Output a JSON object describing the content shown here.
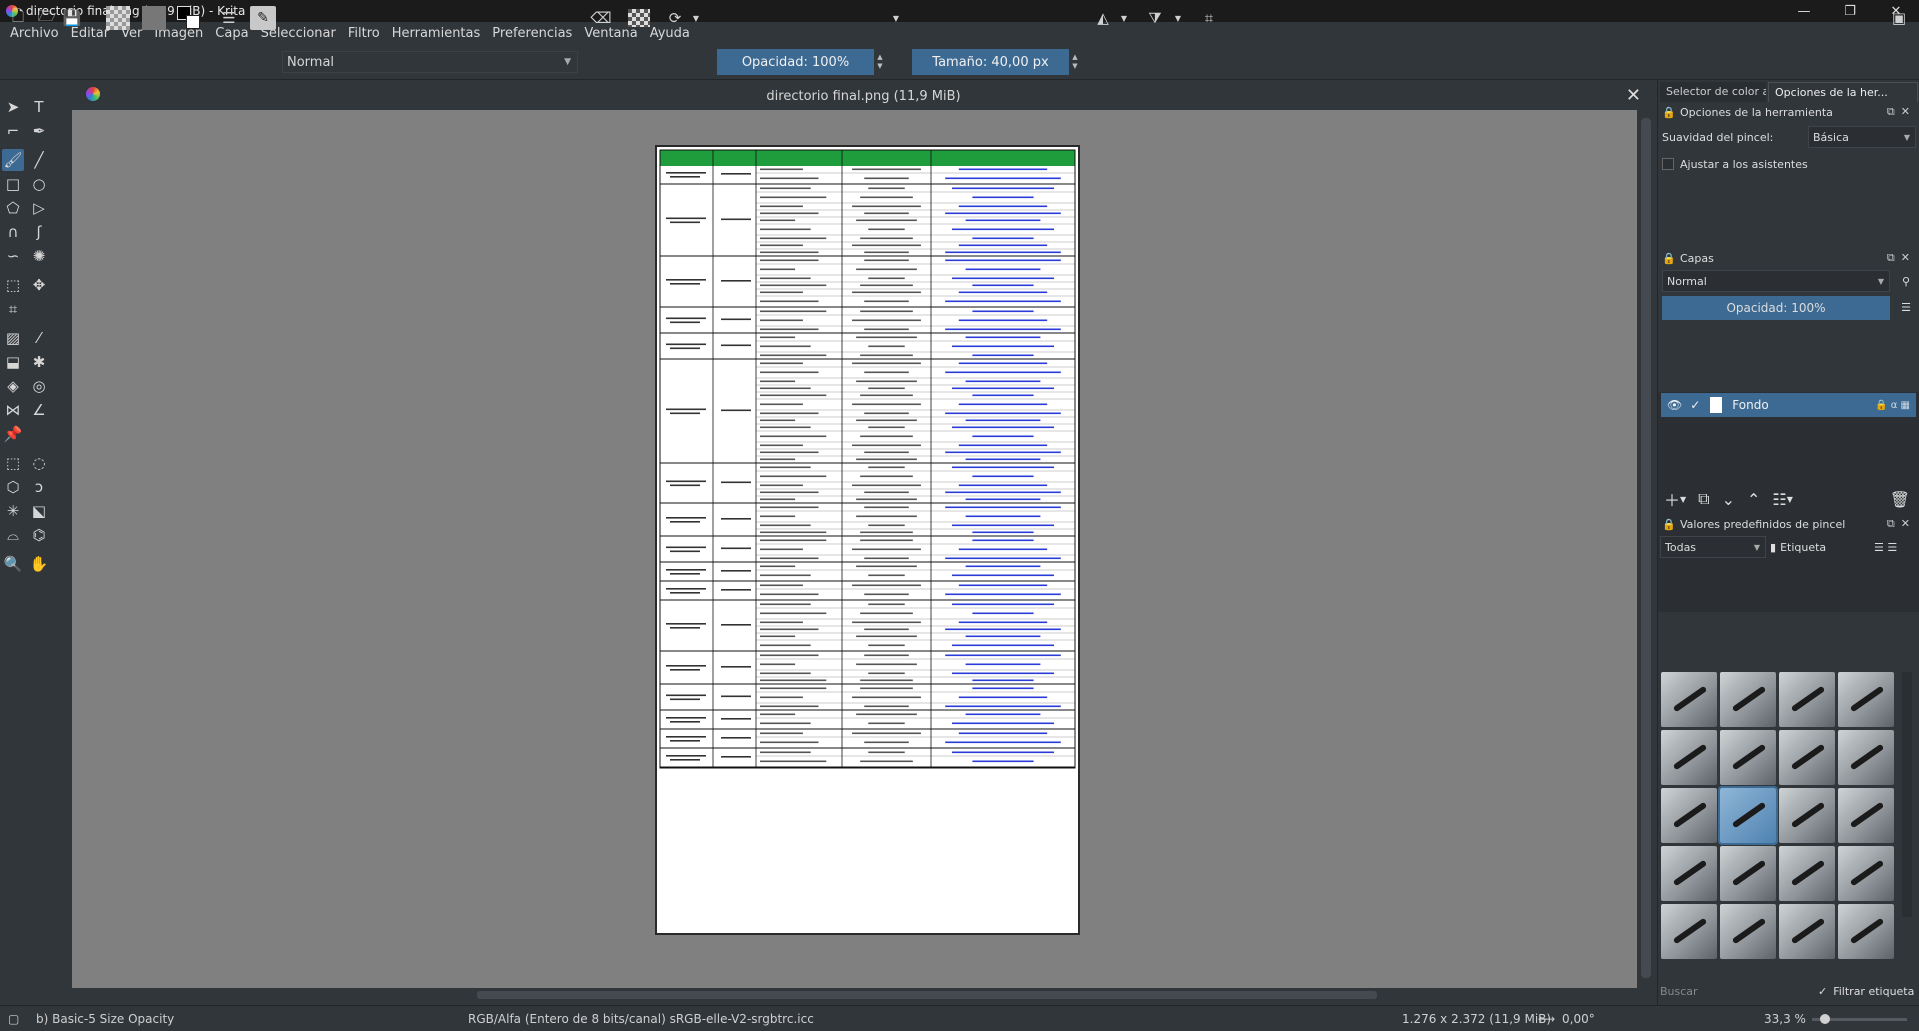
{
  "window": {
    "title": "directorio final.png (11,9 MiB)  - Krita",
    "minimize": "—",
    "maximize": "❐",
    "close": "✕"
  },
  "menu": [
    "Archivo",
    "Editar",
    "Ver",
    "Imagen",
    "Capa",
    "Seleccionar",
    "Filtro",
    "Herramientas",
    "Preferencias",
    "Ventana",
    "Ayuda"
  ],
  "toolbar": {
    "blend_mode": "Normal",
    "opacity_label": "Opacidad: 100%",
    "size_label": "Tamaño: 40,00 px"
  },
  "document": {
    "tab_title": "directorio final.png (11,9 MiB)",
    "close": "✕"
  },
  "dockers": {
    "tab_color_selector": "Selector de color a...",
    "tab_tool_options": "Opciones de la her...",
    "tool_options": {
      "header": "Opciones de la herramienta",
      "smoothing_label": "Suavidad del pincel:",
      "smoothing_value": "Básica",
      "assistants_label": "Ajustar a los asistentes"
    },
    "layers": {
      "header": "Capas",
      "blend_mode": "Normal",
      "opacity_label": "Opacidad:  100%",
      "layer_name": "Fondo"
    },
    "presets": {
      "header": "Valores predefinidos de pincel",
      "filter_all": "Todas",
      "tag_label": "Etiqueta",
      "search_placeholder": "Buscar",
      "filter_tag_label": "Filtrar etiqueta"
    }
  },
  "status": {
    "brush": "b) Basic-5 Size Opacity",
    "color_space": "RGB/Alfa (Entero de 8 bits/canal)  sRGB-elle-V2-srgbtrc.icc",
    "image_size": "1.276 x 2.372 (11,9 MiB)",
    "rotation": "0,00°",
    "zoom": "33,3 %"
  },
  "colors": {
    "accent": "#3d6a93",
    "table_header_green": "#1f9c3c",
    "link_blue": "#2a3bd8"
  }
}
